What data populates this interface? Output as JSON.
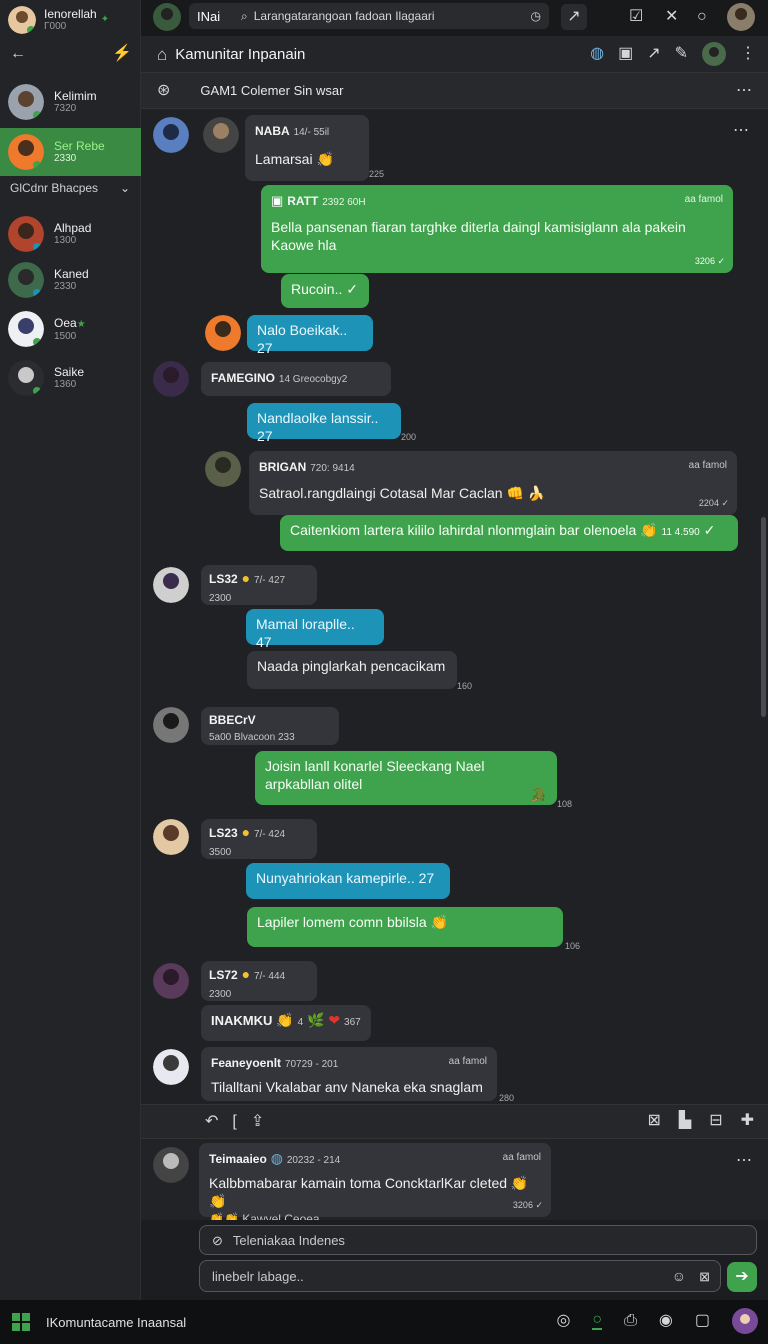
{
  "profile": {
    "name": "Ienorellah",
    "sub": "Γ000"
  },
  "sidebar": {
    "items": [
      {
        "name": "Kelimim",
        "sub": "7320"
      },
      {
        "name": "Ser Rebe",
        "sub": "2330"
      }
    ],
    "group": "GlCdnr Bhacpes",
    "members": [
      {
        "name": "Alhpad",
        "sub": "1300"
      },
      {
        "name": "Kaned",
        "sub": "2330"
      },
      {
        "name": "Oea",
        "sub": "1500"
      },
      {
        "name": "Saike",
        "sub": "1360"
      }
    ]
  },
  "top": {
    "tab": "INai",
    "search": "Larangatarangoan fadoan Ilagaari"
  },
  "channel": {
    "title": "Kamunitar Inpanain",
    "sub": "GAM1 Colemer Sin wsar"
  },
  "messages": {
    "m1": {
      "name": "NABA",
      "meta": "14/- 55il",
      "text": "Lamarsai",
      "time": "225"
    },
    "m2": {
      "name": "RATT",
      "meta": "2392 60H",
      "right": "aa famol",
      "text": "Bella pansenan fiaran targhke diterla daingl kamisiglann ala pakein Kaowe hla",
      "time": "3206"
    },
    "m3": {
      "text": "Rucoin..",
      "time": ""
    },
    "m4": {
      "text": "Nalo Boeikak.. 27"
    },
    "m5": {
      "name": "FAMEGINO",
      "meta": "14 Greocobgy2",
      "text": "Nandlaolke lanssir.. 27",
      "time": "200"
    },
    "m6": {
      "name": "BRIGAN",
      "meta": "720: 9414",
      "right": "aa famol",
      "text": "Satraol.rangdlaingi Cotasal Mar Caclan",
      "time": "2204"
    },
    "m7": {
      "text": "Caitenkiom lartera kililo lahirdal nlonmglain bar olenoela",
      "time": "11 4.590"
    },
    "m8": {
      "name": "LS32",
      "sub": "2300",
      "meta": "7/- 427",
      "text1": "Mamal loraplle.. 47",
      "text2": "Naada pinglarkah pencacikam",
      "time": "160"
    },
    "m9": {
      "name": "BBECrV",
      "meta": "5a00 Blvacoon 233",
      "text": "Joisin lanll konarlel Sleeckang Nael arpkabllan olitel",
      "time": "108"
    },
    "m10": {
      "name": "LS23",
      "sub": "3500",
      "meta": "7/- 424",
      "text1": "Nunyahriokan kamepirle.. 27",
      "text2": "Lapiler lomem comn bbilsla",
      "time": "106"
    },
    "m11": {
      "name": "LS72",
      "sub": "2300",
      "meta": "7/- 444",
      "text": "INAKMKU",
      "extra": "4",
      "count": "367"
    },
    "m12": {
      "name": "Feaneyoenlt",
      "meta": "70729 - 201",
      "right": "aa famol",
      "text": "Tilalltani Vkalabar anv Naneka eka snaglam",
      "time": "280"
    }
  },
  "pinned": {
    "name": "Teimaaieo",
    "meta": "20232 - 214",
    "right": "aa famol",
    "text": "Kalbbmabarar kamain toma ConcktarlKar cleted",
    "sub": "Kawyel Ceoea",
    "time": "3206"
  },
  "compose": {
    "search_placeholder": "Teleniakaa Indenes",
    "msg_placeholder": "linebelr labage.."
  },
  "taskbar": {
    "label": "IKomuntacame Inaansal"
  },
  "colors": {
    "accent": "#3fa34d",
    "blue": "#1d93b8"
  }
}
